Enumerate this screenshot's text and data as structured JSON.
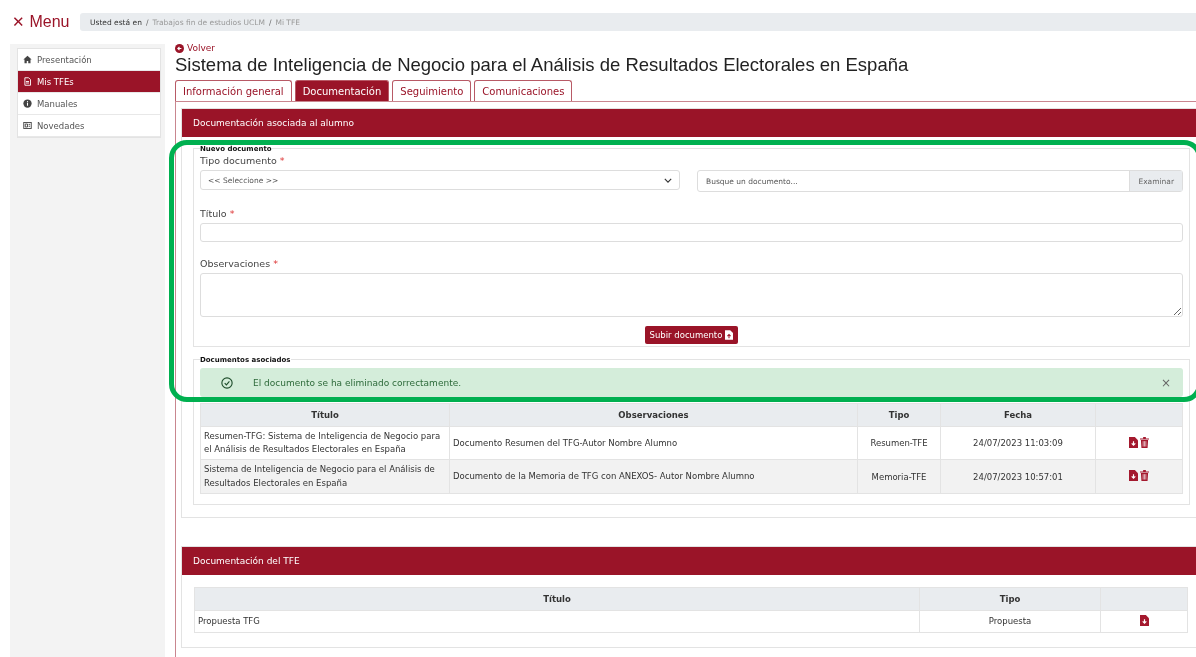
{
  "menu": {
    "icon": "✕",
    "label": "Menu"
  },
  "breadcrumb": {
    "prefix": "Usted está en",
    "separator": "/",
    "items": [
      "Trabajos fin de estudios UCLM",
      "Mi TFE"
    ]
  },
  "sidebar": {
    "items": [
      {
        "label": "Presentación",
        "kind": "home",
        "selected": false
      },
      {
        "label": "Mis TFEs",
        "kind": "file",
        "selected": true
      },
      {
        "label": "Manuales",
        "kind": "info",
        "selected": false
      },
      {
        "label": "Novedades",
        "kind": "news",
        "selected": false
      }
    ]
  },
  "back_link": "Volver",
  "title": "Sistema de Inteligencia de Negocio para el Análisis de Resultados Electorales en España",
  "tabs": [
    {
      "label": "Información general",
      "selected": false
    },
    {
      "label": "Documentación",
      "selected": true
    },
    {
      "label": "Seguimiento",
      "selected": false
    },
    {
      "label": "Comunicaciones",
      "selected": false
    }
  ],
  "student_docs": {
    "header": "Documentación asociada al alumno",
    "new_document": {
      "legend": "Nuevo documento",
      "type_field": {
        "label": "Tipo documento",
        "mark": "*",
        "value": "<< Seleccione >>"
      },
      "file_field": {
        "placeholder": "Busque un documento...",
        "button": "Examinar"
      },
      "title_field": {
        "label": "Título",
        "mark": "*"
      },
      "notes_field": {
        "label": "Observaciones",
        "mark": "*"
      },
      "submit": "Subir documento"
    },
    "associated": {
      "legend": "Documentos asociados",
      "alert": {
        "text": "El documento se ha eliminado correctamente.",
        "close": "×"
      },
      "columns": [
        "Título",
        "Observaciones",
        "Tipo",
        "Fecha"
      ],
      "rows": [
        {
          "title": "Resumen-TFG: Sistema de Inteligencia de Negocio para el Análisis de Resultados Electorales en España",
          "notes": "Documento Resumen del TFG-Autor Nombre Alumno",
          "type": "Resumen-TFE",
          "date": "24/07/2023 11:03:09"
        },
        {
          "title": "Sistema de Inteligencia de Negocio para el Análisis de Resultados Electorales en España",
          "notes": "Documento de la Memoria de TFG con ANEXOS- Autor Nombre Alumno",
          "type": "Memoria-TFE",
          "date": "24/07/2023 10:57:01"
        }
      ]
    }
  },
  "tfe_docs": {
    "header": "Documentación del TFE",
    "columns": [
      "Título",
      "Tipo"
    ],
    "rows": [
      {
        "title": "Propuesta TFG",
        "type": "Propuesta"
      }
    ]
  }
}
